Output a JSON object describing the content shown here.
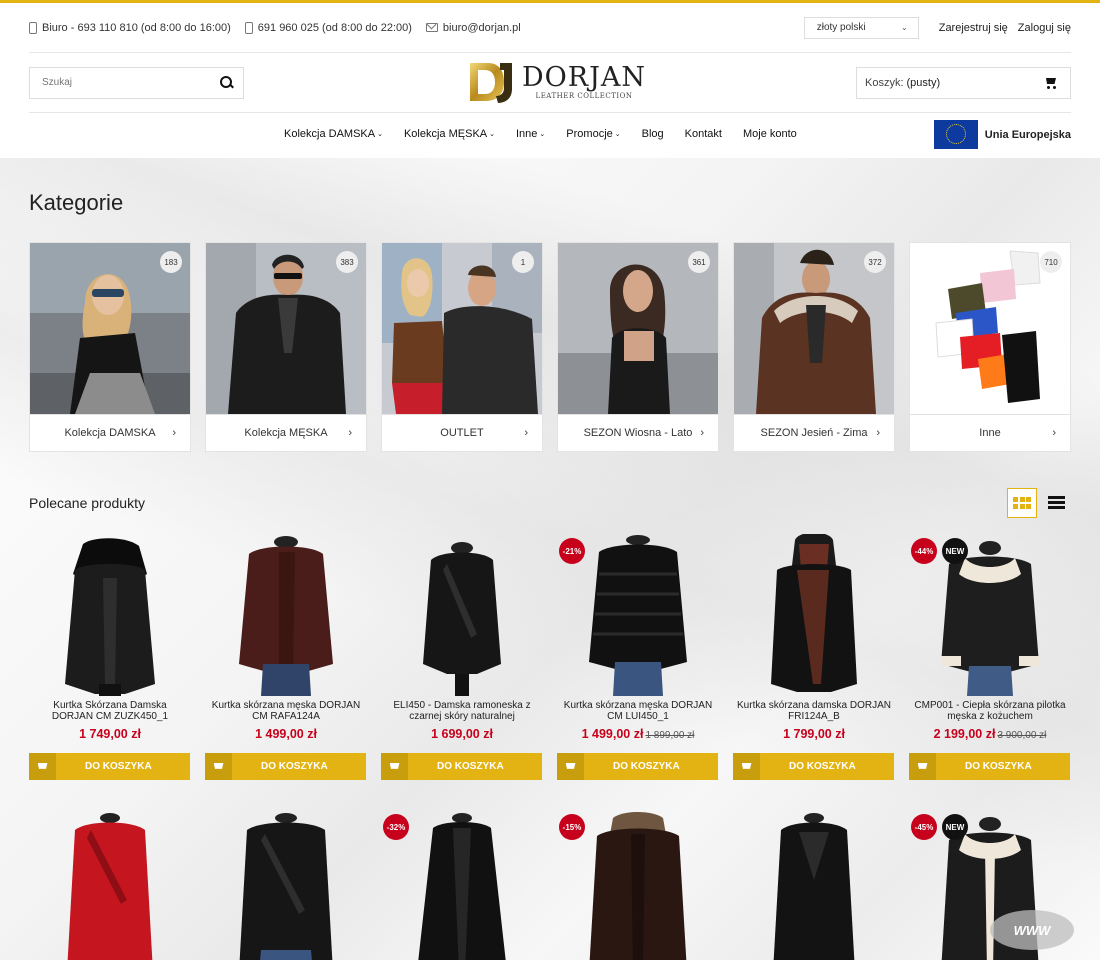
{
  "top": {
    "office_phone": "Biuro - 693 110 810 (od 8:00 do 16:00)",
    "mobile_phone": "691 960 025 (od 8:00 do 22:00)",
    "email": "biuro@dorjan.pl",
    "currency": "złoty polski",
    "register": "Zarejestruj się",
    "login": "Zaloguj się"
  },
  "header": {
    "search_placeholder": "Szukaj",
    "logo_title": "DORJAN",
    "logo_sub": "LEATHER COLLECTION",
    "cart_label": "Koszyk:",
    "cart_value": "(pusty)"
  },
  "nav": {
    "items": [
      "Kolekcja DAMSKA",
      "Kolekcja MĘSKA",
      "Inne",
      "Promocje",
      "Blog",
      "Kontakt",
      "Moje konto"
    ],
    "eu_label": "Unia Europejska"
  },
  "categories_title": "Kategorie",
  "categories": [
    {
      "label": "Kolekcja DAMSKA",
      "count": "183"
    },
    {
      "label": "Kolekcja MĘSKA",
      "count": "383"
    },
    {
      "label": "OUTLET",
      "count": "1"
    },
    {
      "label": "SEZON Wiosna - Lato",
      "count": "361"
    },
    {
      "label": "SEZON Jesień - Zima",
      "count": "372"
    },
    {
      "label": "Inne",
      "count": "710"
    }
  ],
  "products_title": "Polecane produkty",
  "add_to_cart": "DO KOSZYKA",
  "products": [
    {
      "name": "Kurtka Skórzana Damska DORJAN CM ZUZK450_1",
      "price": "1 749,00 zł",
      "old_price": "",
      "discount": "",
      "new": ""
    },
    {
      "name": "Kurtka skórzana męska DORJAN CM RAFA124A",
      "price": "1 499,00 zł",
      "old_price": "",
      "discount": "",
      "new": ""
    },
    {
      "name": "ELI450 - Damska ramoneska z czarnej skóry naturalnej",
      "price": "1 699,00 zł",
      "old_price": "",
      "discount": "",
      "new": ""
    },
    {
      "name": "Kurtka skórzana męska DORJAN CM LUI450_1",
      "price": "1 499,00 zł",
      "old_price": "1 899,00 zł",
      "discount": "-21%",
      "new": ""
    },
    {
      "name": "Kurtka skórzana damska DORJAN FRI124A_B",
      "price": "1 799,00 zł",
      "old_price": "",
      "discount": "",
      "new": ""
    },
    {
      "name": "CMP001 - Ciepła skórzana pilotka męska z kożuchem",
      "price": "2 199,00 zł",
      "old_price": "3 900,00 zł",
      "discount": "-44%",
      "new": "NEW"
    }
  ],
  "products_row2": [
    {
      "discount": "",
      "new": ""
    },
    {
      "discount": "",
      "new": ""
    },
    {
      "discount": "-32%",
      "new": ""
    },
    {
      "discount": "-15%",
      "new": ""
    },
    {
      "discount": "",
      "new": ""
    },
    {
      "discount": "-45%",
      "new": "NEW"
    }
  ],
  "watermark": "WWW",
  "colors": {
    "accent": "#e2b313",
    "price": "#c7001b",
    "eu_blue": "#0d3a9e"
  }
}
